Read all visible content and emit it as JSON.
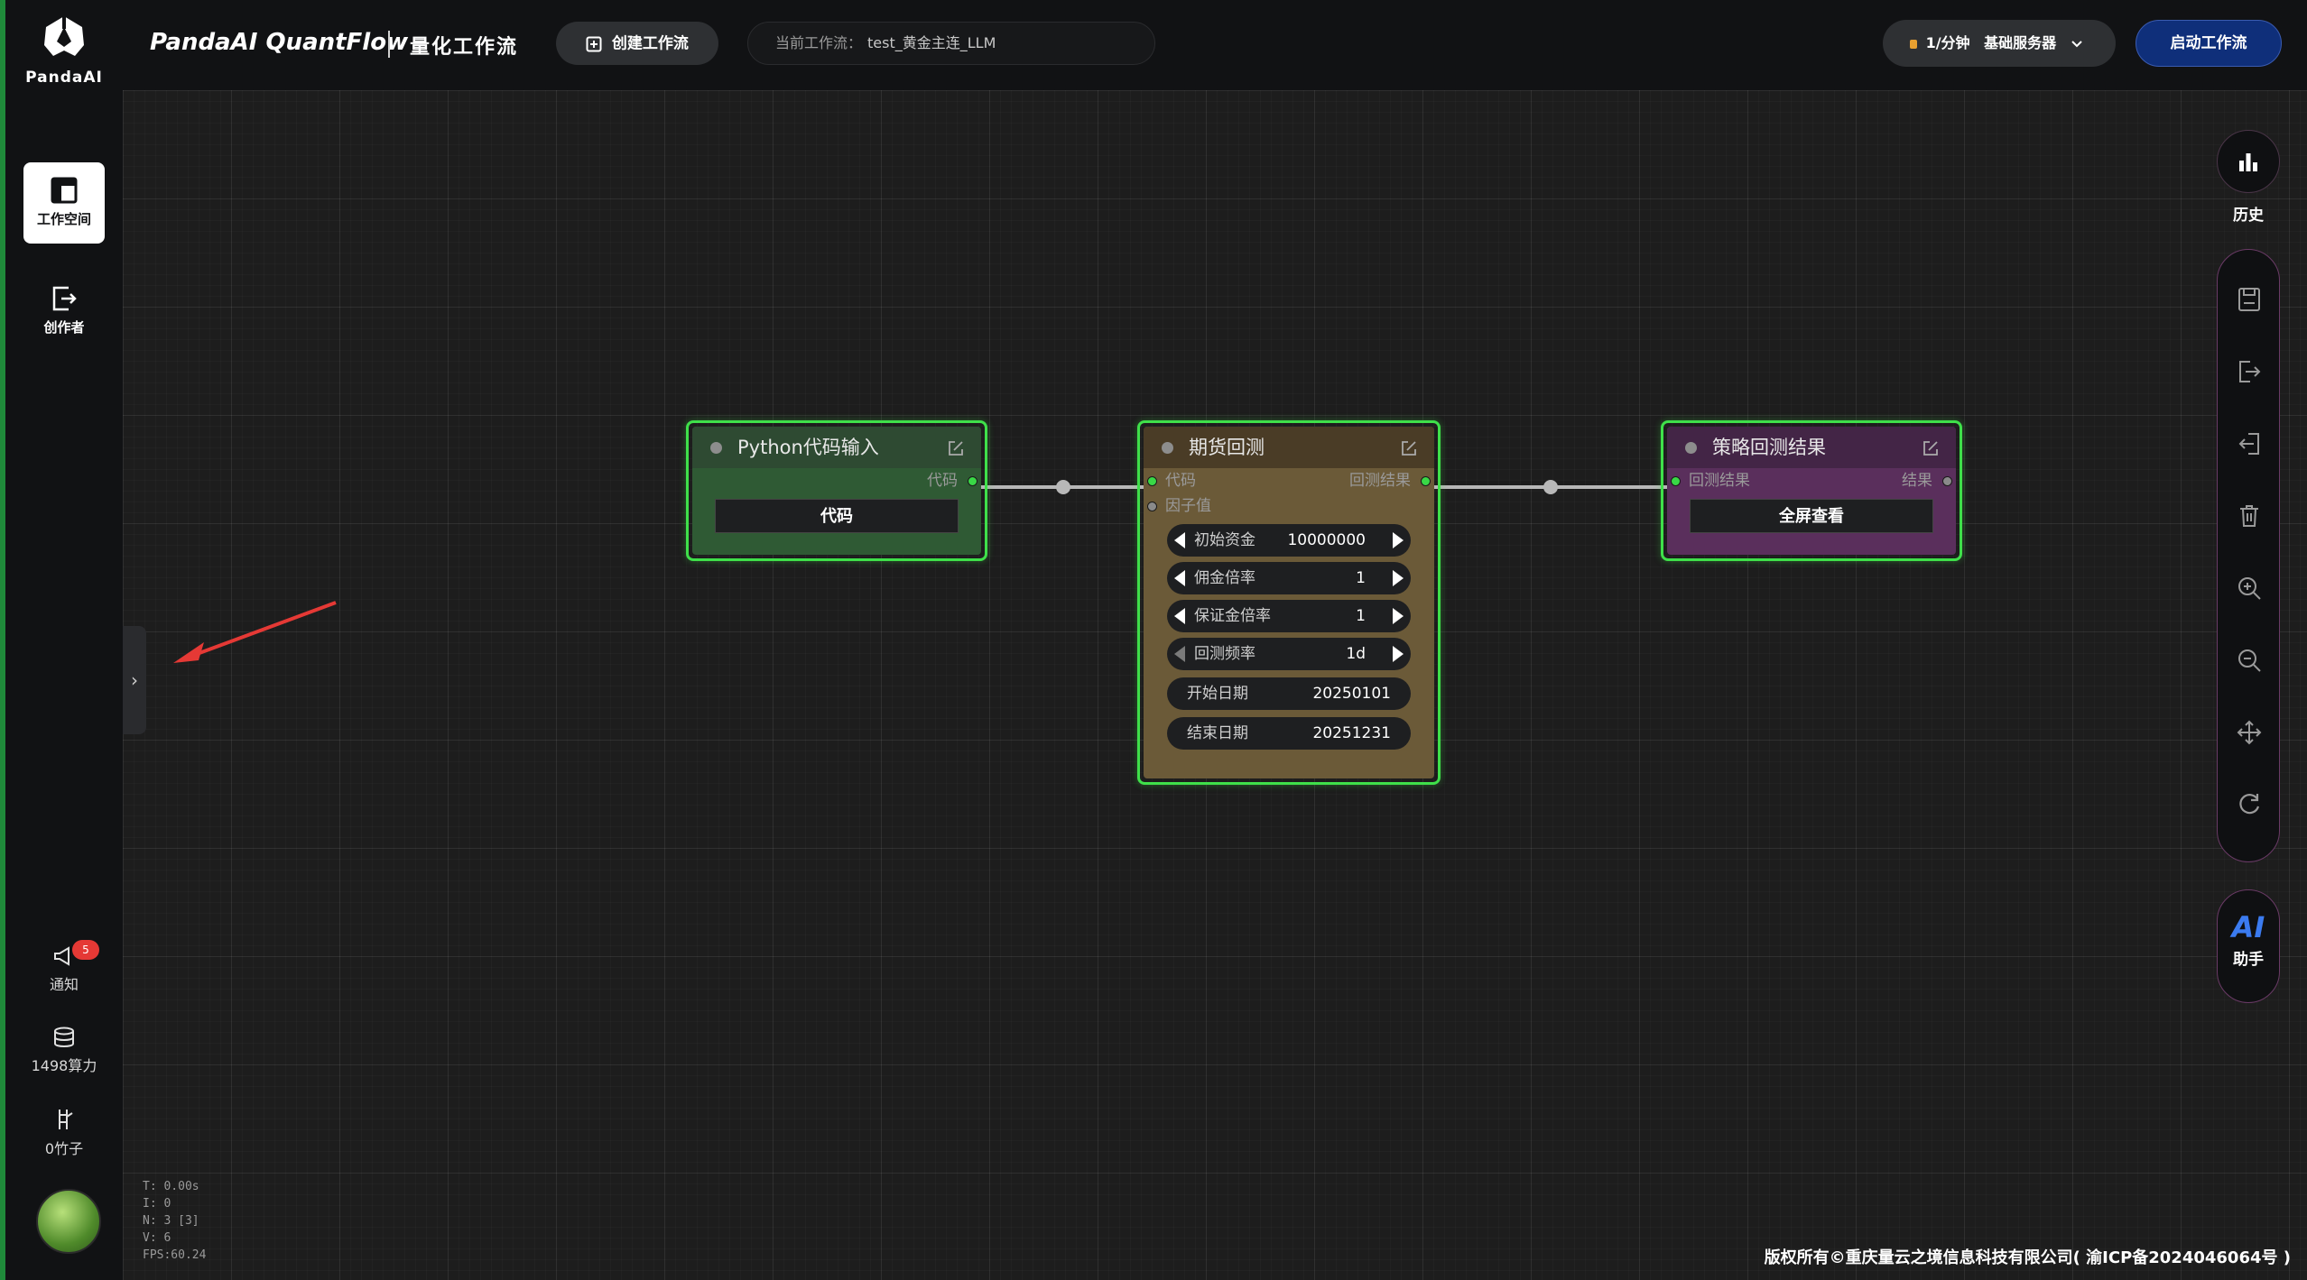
{
  "sidebar": {
    "logo_text": "PandaAI",
    "nav": [
      {
        "label": "工作空间",
        "icon": "workspace-icon",
        "active": true
      },
      {
        "label": "创作者",
        "icon": "creator-icon",
        "active": false
      }
    ],
    "notifications": {
      "label": "通知",
      "badge": "5",
      "icon": "megaphone-icon"
    },
    "compute": {
      "label": "1498算力",
      "icon": "database-icon"
    },
    "bamboo": {
      "label": "0竹子",
      "icon": "bamboo-icon"
    }
  },
  "header": {
    "brand": "PandaAI QuantFlow",
    "subtitle": "量化工作流",
    "create_button": "创建工作流",
    "current_workflow_label": "当前工作流：",
    "current_workflow_value": "test_黄金主连_LLM",
    "server_rate": "1/分钟",
    "server_name": "基础服务器",
    "start_button": "启动工作流"
  },
  "toolbar_right": {
    "history_label": "历史",
    "tools": [
      "save-icon",
      "export-icon",
      "import-icon",
      "delete-icon",
      "zoom-in-icon",
      "zoom-out-icon",
      "move-icon",
      "refresh-icon"
    ],
    "ai_text": "AI",
    "ai_label": "助手"
  },
  "nodes": {
    "python": {
      "title": "Python代码输入",
      "output_port": "代码",
      "button": "代码"
    },
    "futures": {
      "title": "期货回测",
      "input_code": "代码",
      "input_factor": "因子值",
      "output": "回测结果",
      "widgets": [
        {
          "label": "初始资金",
          "value": "10000000",
          "arrows": true
        },
        {
          "label": "佣金倍率",
          "value": "1",
          "arrows": true
        },
        {
          "label": "保证金倍率",
          "value": "1",
          "arrows": true
        },
        {
          "label": "回测频率",
          "value": "1d",
          "arrows": true
        }
      ],
      "dates": [
        {
          "label": "开始日期",
          "value": "20250101"
        },
        {
          "label": "结束日期",
          "value": "20251231"
        }
      ]
    },
    "result": {
      "title": "策略回测结果",
      "input": "回测结果",
      "output": "结果",
      "button": "全屏查看"
    }
  },
  "stats": {
    "t": "T: 0.00s",
    "i": "I: 0",
    "n": "N: 3 [3]",
    "v": "V: 6",
    "fps": "FPS:60.24"
  },
  "footer": {
    "copyright": "版权所有©重庆量云之境信息科技有限公司( 渝ICP备2024046064号 )"
  },
  "colors": {
    "accent_green": "#3fe04a",
    "start_button": "#0f2f7a",
    "python_node": "#2f5a34",
    "futures_node": "#6b5a38",
    "result_node": "#5a2f5c"
  }
}
